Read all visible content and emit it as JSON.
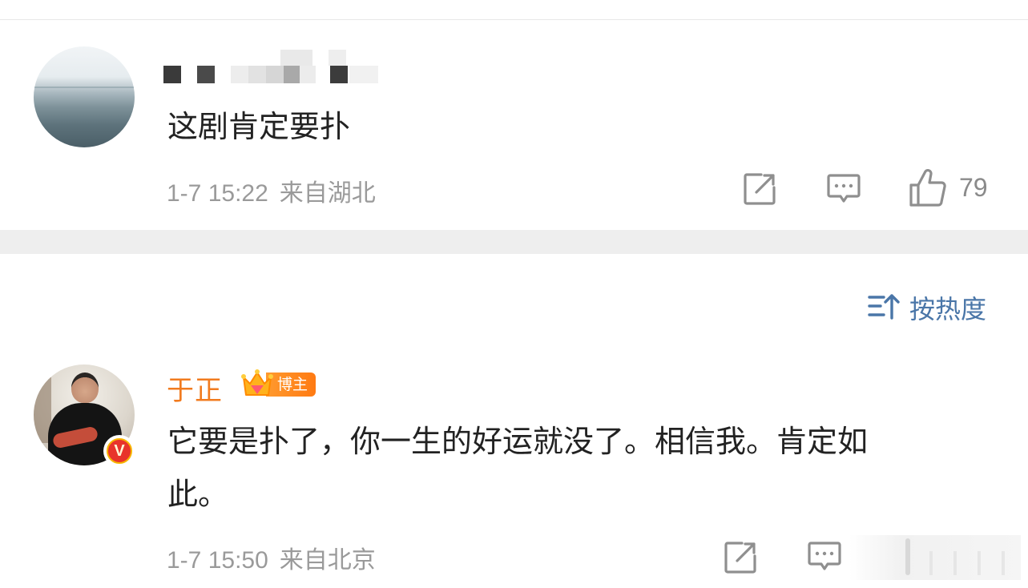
{
  "comments": [
    {
      "username_hidden": true,
      "avatar": "sea-horizon-avatar",
      "text": "这剧肯定要扑",
      "time": "1-7 15:22",
      "location": "来自湖北",
      "likes": "79",
      "icons": [
        "share-icon",
        "comment-icon",
        "like-icon"
      ]
    },
    {
      "username": "于正",
      "badge": "博主",
      "badge_crown": "crown-icon",
      "verified": "V",
      "avatar": "person-avatar",
      "text_line1": "它要是扑了，你一生的好运就没了。相信我。肯定如",
      "text_line2": "此。",
      "time": "1-7 15:50",
      "location": "来自北京",
      "icons": [
        "share-icon",
        "comment-icon"
      ]
    }
  ],
  "sort": {
    "label": "按热度",
    "icon": "sort-icon"
  },
  "colors": {
    "username": "#f17b1f",
    "sort": "#4a76a8",
    "meta": "#9a9a9a",
    "text": "#222222",
    "band": "#eeeeee"
  }
}
